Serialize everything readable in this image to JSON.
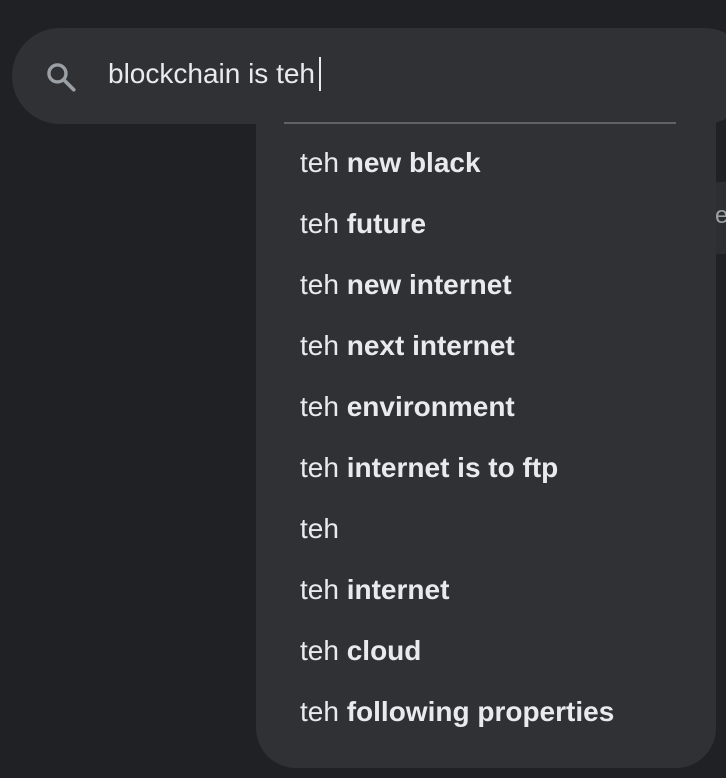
{
  "search": {
    "query": "blockchain is teh",
    "icon": "search-icon"
  },
  "suggestions": [
    {
      "prefix": "teh",
      "completion": "new black"
    },
    {
      "prefix": "teh",
      "completion": "future"
    },
    {
      "prefix": "teh",
      "completion": "new internet"
    },
    {
      "prefix": "teh",
      "completion": "next internet"
    },
    {
      "prefix": "teh",
      "completion": "environment"
    },
    {
      "prefix": "teh",
      "completion": "internet is to ftp"
    },
    {
      "prefix": "teh",
      "completion": ""
    },
    {
      "prefix": "teh",
      "completion": "internet"
    },
    {
      "prefix": "teh",
      "completion": "cloud"
    },
    {
      "prefix": "teh",
      "completion": "following properties"
    }
  ],
  "background": {
    "partial_text": "e"
  },
  "colors": {
    "page_background": "#202124",
    "surface": "#303134",
    "text": "#e8eaed",
    "icon": "#9aa0a6",
    "divider": "#5f6368"
  }
}
